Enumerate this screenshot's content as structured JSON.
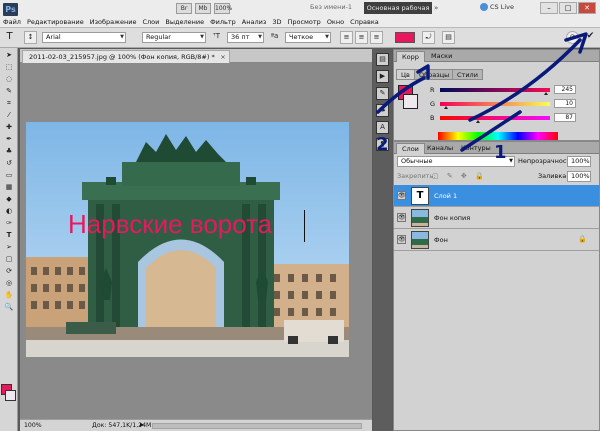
{
  "menubar": {
    "app_logo": "Ps",
    "menus": [
      "Файл",
      "Редактирование",
      "Изображение",
      "Слои",
      "Выделение",
      "Фильтр",
      "Анализ",
      "3D",
      "Просмотр",
      "Окно",
      "Справка"
    ],
    "doc_title": "Без имени-1",
    "workspace": "Основная рабочая среда",
    "cs_live": "CS Live",
    "window_buttons": [
      "–",
      "□",
      "✕"
    ]
  },
  "options": {
    "font_family": "Arial",
    "font_style": "Regular",
    "font_size": "36 пт",
    "antialias": "Четкое",
    "text_color": "#e8185e"
  },
  "document": {
    "tab_title": "2011-02-03_215957.jpg @ 100% (Фон копия, RGB/8#) *",
    "overlay_text": "Нарвские ворота",
    "status_zoom": "100%",
    "status_doc": "Док: 547,1K/1,24M"
  },
  "color_panel": {
    "tabs": [
      "Корр",
      "Маски"
    ],
    "subtabs": [
      "Цв",
      "Образцы",
      "Стили"
    ],
    "fg_color": "#e8185e",
    "bg_color": "#f0e8ef",
    "R": "245",
    "G": "10",
    "B": "87"
  },
  "layers_panel": {
    "tabs": [
      "Слои",
      "Каналы",
      "Контуры"
    ],
    "blend_mode": "Обычные",
    "opacity_label": "Непрозрачность:",
    "opacity": "100%",
    "lock_label": "Закрепить:",
    "fill_label": "Заливка:",
    "fill": "100%",
    "layers": [
      {
        "name": "Слой 1",
        "type": "text",
        "selected": true
      },
      {
        "name": "Фон копия",
        "type": "image",
        "selected": false
      },
      {
        "name": "Фон",
        "type": "image",
        "selected": false,
        "locked": true
      }
    ]
  },
  "annotations": {
    "labels": [
      "1",
      "2"
    ],
    "color": "#0a1a7a"
  }
}
